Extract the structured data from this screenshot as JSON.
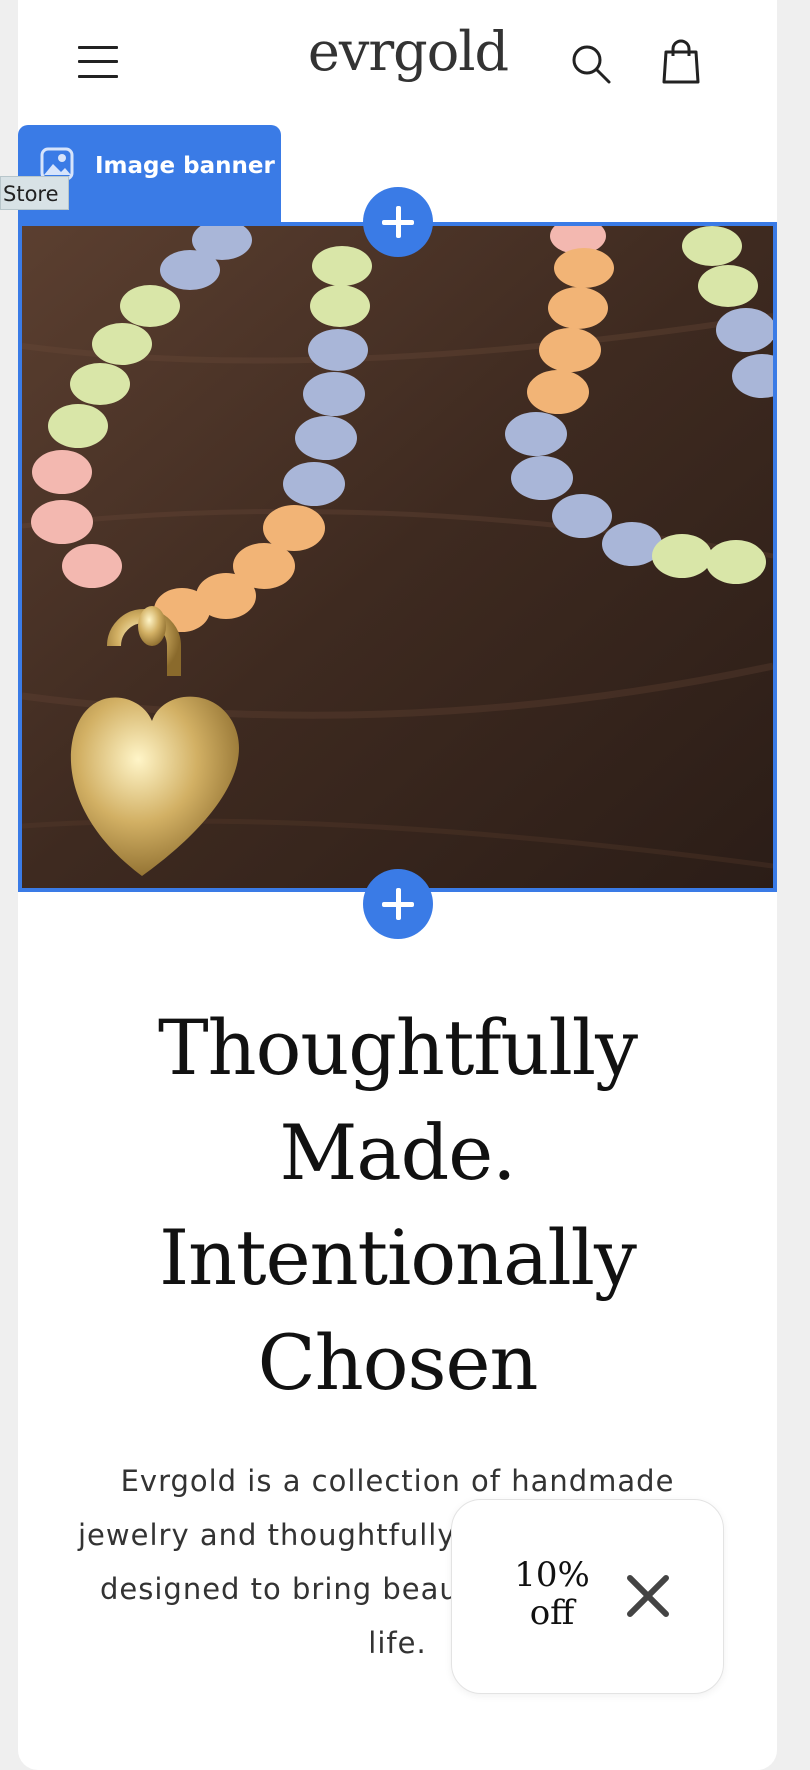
{
  "header": {
    "logo": "evrgold"
  },
  "editor": {
    "section_label": "Image banner",
    "store_tag": "Store",
    "accent_color": "#3a7be6"
  },
  "banner": {
    "image_alt": "Beaded necklaces with gold heart padlock pendant on wooden surface"
  },
  "content": {
    "headline_lines": [
      "Thoughtfully",
      "Made.",
      "Intentionally",
      "Chosen"
    ],
    "body_lines": [
      "Evrgold is a collection of handmade",
      "jewelry and thoughtfully",
      "designed to bring beau",
      "life."
    ]
  },
  "popup": {
    "discount_line1": "10%",
    "discount_line2": "off"
  },
  "icons": {
    "menu": "hamburger-icon",
    "search": "search-icon",
    "cart": "cart-icon",
    "section": "image-section-icon",
    "add": "plus-icon",
    "close": "close-icon"
  }
}
